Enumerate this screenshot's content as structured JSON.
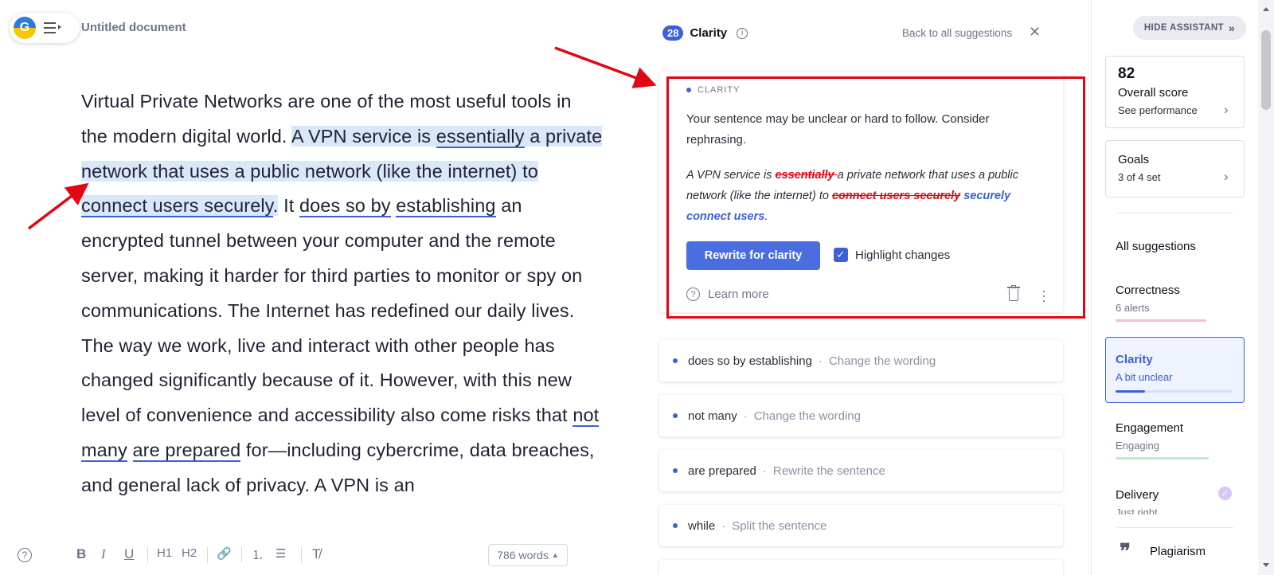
{
  "document": {
    "title": "Untitled document",
    "text": {
      "p1": "Virtual Private Networks are one of the most useful tools in the modern digital world. ",
      "hl_a": "A VPN service is ",
      "hl_essentially": "essentially",
      "hl_b": " a private network that uses a public network (like the internet) to ",
      "hl_connect": "connect users securely",
      "hl_c": ".",
      "p2": " It ",
      "does_so_by": "does so by",
      "sp1": " ",
      "establishing": "establishing",
      "p3": " an encrypted tunnel between your computer and the remote server, making it harder for third parties to monitor or spy on communications. The Internet has redefined our daily lives. The way we work, live and interact with other people has changed significantly because of it. However, with this new level of convenience and accessibility also come risks that ",
      "not": "not",
      "sp2": " ",
      "many": "many",
      "sp3": " ",
      "are_prepared": "are prepared",
      "p4": " for—including cybercrime, data breaches, and general lack of privacy. A VPN is an"
    },
    "word_count": "786 words"
  },
  "toolbar": {
    "help": "?",
    "bold": "B",
    "italic": "I",
    "underline": "U",
    "h1": "H1",
    "h2": "H2",
    "link_icon": "🔗",
    "ol_icon": "⒈",
    "ul_icon": "☰",
    "clear_icon": "T̸"
  },
  "panel": {
    "count": "28",
    "title": "Clarity",
    "back": "Back to all suggestions",
    "main_card": {
      "category": "CLARITY",
      "message": "Your sentence may be unclear or hard to follow. Consider rephrasing.",
      "preview_a": "A VPN service is ",
      "preview_del1": "essentially ",
      "preview_b": "a private network that uses a public network (like the internet) to ",
      "preview_del2": "connect users securely",
      "preview_sp": " ",
      "preview_ins": "securely connect users",
      "preview_end": ".",
      "rewrite_button": "Rewrite for clarity",
      "highlight_label": "Highlight changes",
      "highlight_checked": true,
      "learn_more": "Learn more"
    },
    "suggestions": [
      {
        "word": "does so by establishing",
        "hint": "Change the wording"
      },
      {
        "word": "not many",
        "hint": "Change the wording"
      },
      {
        "word": "are prepared",
        "hint": "Rewrite the sentence"
      },
      {
        "word": "while",
        "hint": "Split the sentence"
      }
    ],
    "separator": "·"
  },
  "sidebar": {
    "hide_assistant": "HIDE ASSISTANT",
    "score": "82",
    "score_label": "Overall score",
    "score_sub": "See performance",
    "goals_label": "Goals",
    "goals_sub": "3 of 4 set",
    "all_suggestions": "All suggestions",
    "categories": [
      {
        "name": "Correctness",
        "sub": "6 alerts",
        "color": "#f4c1c8",
        "level": 0.78
      },
      {
        "name": "Clarity",
        "sub": "A bit unclear",
        "color": "#3d60d8",
        "level": 0.25
      },
      {
        "name": "Engagement",
        "sub": "Engaging",
        "color": "#bfe8d9",
        "level": 0.8
      },
      {
        "name": "Delivery",
        "sub": "Just right",
        "color": "#d8c6f3",
        "level": 1
      }
    ],
    "plagiarism": "Plagiarism"
  },
  "colors": {
    "accent": "#3d60d8",
    "annotation_red": "#e30613",
    "highlight": "#d9e7fb"
  }
}
